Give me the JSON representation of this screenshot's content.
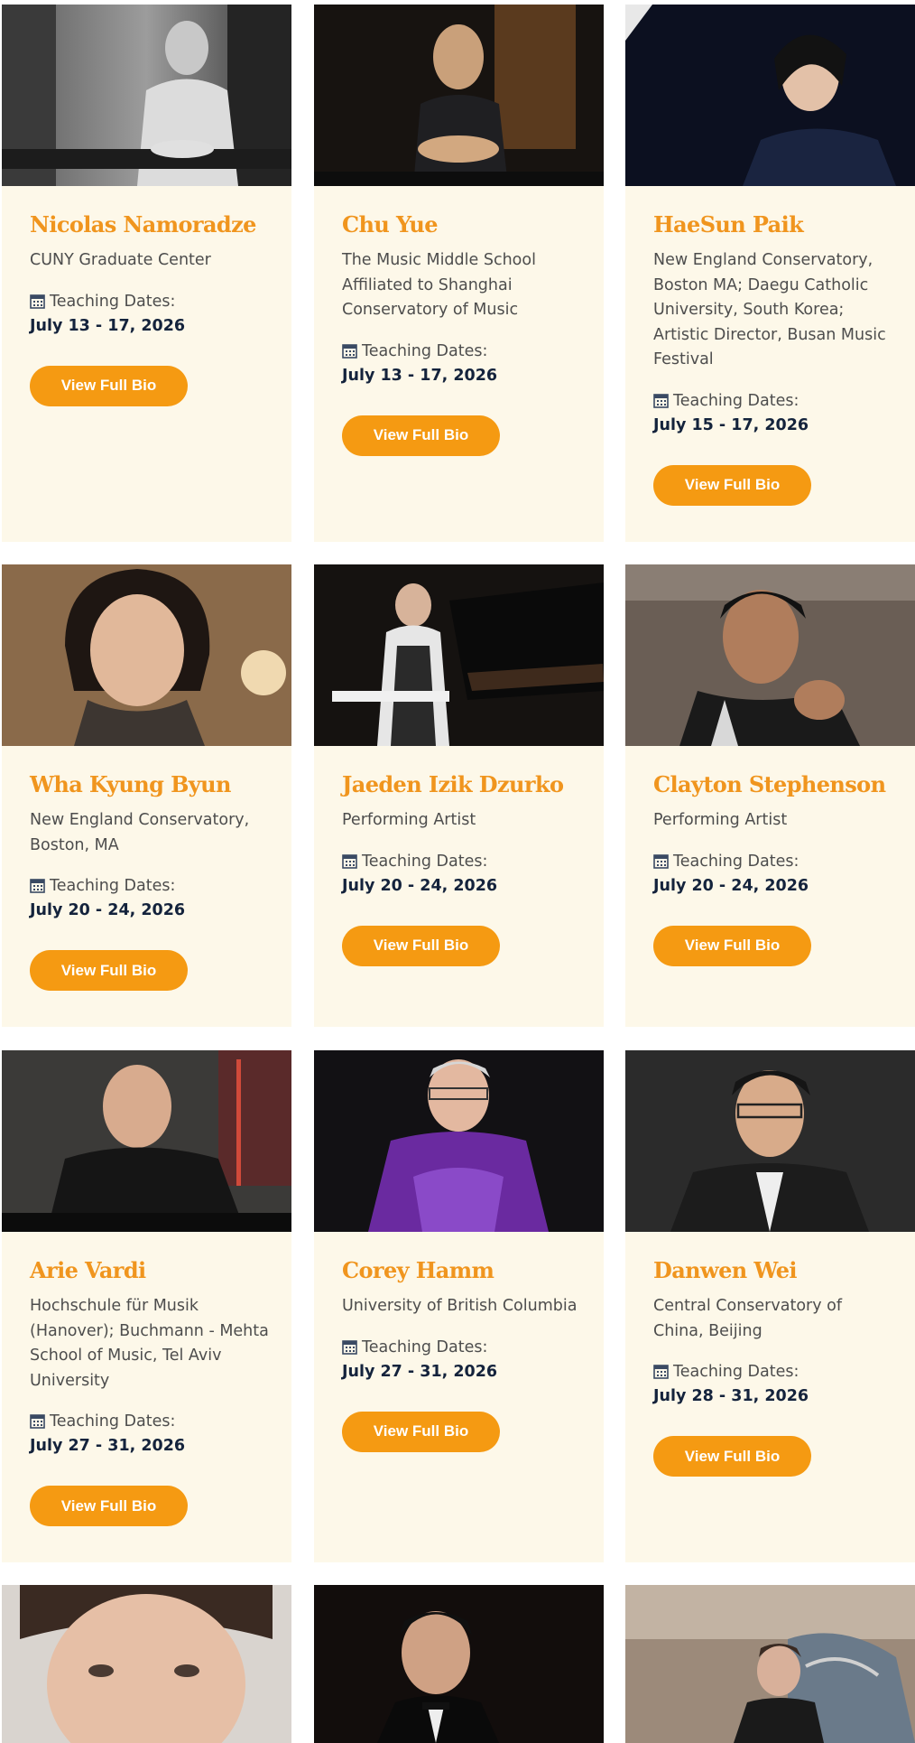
{
  "teaching_dates_label": "Teaching Dates:",
  "bio_button_label": "View Full Bio",
  "colors": {
    "card_bg": "#fdf8e9",
    "name": "#f0951e",
    "button": "#f59a12",
    "dates": "#14233c"
  },
  "faculty": [
    {
      "name": "Nicolas Namoradze",
      "affiliation": "CUNY Graduate Center",
      "dates": "July 13 - 17, 2026"
    },
    {
      "name": "Chu Yue",
      "affiliation": "The Music Middle School Affiliated to Shanghai Conservatory of Music",
      "dates": "July 13 - 17, 2026"
    },
    {
      "name": "HaeSun Paik",
      "affiliation": "New England Conservatory, Boston MA; Daegu Catholic University, South Korea; Artistic Director, Busan Music Festival",
      "dates": "July 15 - 17, 2026"
    },
    {
      "name": "Wha Kyung Byun",
      "affiliation": "New England Conservatory, Boston, MA",
      "dates": "July 20 - 24, 2026"
    },
    {
      "name": "Jaeden Izik Dzurko",
      "affiliation": "Performing Artist",
      "dates": "July 20 - 24, 2026"
    },
    {
      "name": "Clayton Stephenson",
      "affiliation": "Performing Artist",
      "dates": "July 20 - 24, 2026"
    },
    {
      "name": "Arie Vardi",
      "affiliation": "Hochschule für Musik (Hanover); Buchmann - Mehta School of Music, Tel Aviv University",
      "dates": "July 27 - 31, 2026"
    },
    {
      "name": "Corey Hamm",
      "affiliation": "University of British Columbia",
      "dates": "July 27 - 31, 2026"
    },
    {
      "name": "Danwen Wei",
      "affiliation": "Central Conservatory of China, Beijing",
      "dates": "July 28 - 31, 2026"
    }
  ]
}
